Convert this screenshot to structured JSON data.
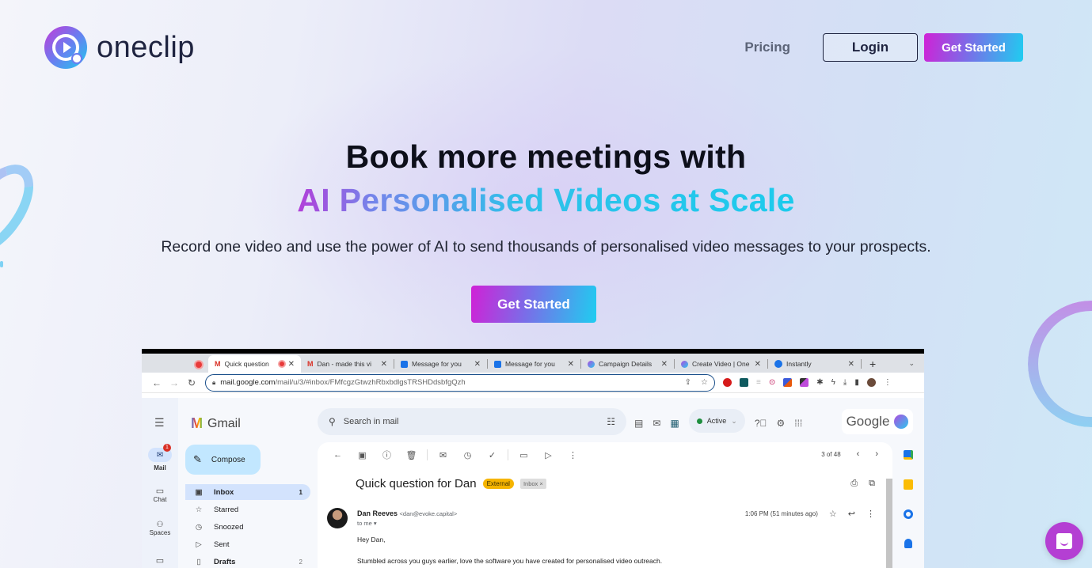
{
  "brand": {
    "name": "oneclip",
    "logo_icon": "play-circle-icon"
  },
  "nav": {
    "pricing": "Pricing",
    "login": "Login",
    "get_started": "Get Started"
  },
  "hero": {
    "title": "Book more meetings with",
    "subtitle": "AI Personalised Videos at Scale",
    "description": "Record one video and use the power of AI to send thousands of personalised video messages to your prospects.",
    "cta": "Get Started"
  },
  "colors": {
    "gradient_start": "#d021d6",
    "gradient_end": "#1fcdf0",
    "dark_text": "#1f2440",
    "chat_fab": "#b43fd3"
  },
  "mockup": {
    "tabs": [
      {
        "label": "Quick question",
        "icon": "gmail-icon",
        "active": true
      },
      {
        "label": "Dan - made this vi",
        "icon": "gmail-icon"
      },
      {
        "label": "Message for you",
        "icon": "video-icon"
      },
      {
        "label": "Message for you",
        "icon": "video-icon"
      },
      {
        "label": "Campaign Details",
        "icon": "oneclip-icon"
      },
      {
        "label": "Create Video | One",
        "icon": "oneclip-icon"
      },
      {
        "label": "Instantly",
        "icon": "instantly-icon"
      }
    ],
    "url_host": "mail.google.com",
    "url_path": "/mail/u/3/#inbox/FMfcgzGtwzhRbxbdlgsTRSHDdsbfgQzh",
    "gmail": {
      "app_name": "Gmail",
      "compose": "Compose",
      "search_placeholder": "Search in mail",
      "status": "Active",
      "google_label": "Google",
      "rail": [
        {
          "label": "Mail",
          "badge": "1"
        },
        {
          "label": "Chat"
        },
        {
          "label": "Spaces"
        },
        {
          "label": "Meet"
        }
      ],
      "folders": [
        {
          "label": "Inbox",
          "count": "1",
          "active": true
        },
        {
          "label": "Starred",
          "count": ""
        },
        {
          "label": "Snoozed",
          "count": ""
        },
        {
          "label": "Sent",
          "count": ""
        },
        {
          "label": "Drafts",
          "count": "2"
        }
      ],
      "pager": "3 of 48",
      "subject": "Quick question for Dan",
      "labels": [
        "External",
        "Inbox ×"
      ],
      "sender_name": "Dan Reeves",
      "sender_email": "<dan@evoke.capital>",
      "to": "to me ▾",
      "time": "1:06 PM (51 minutes ago)",
      "greeting": "Hey Dan,",
      "body": "Stumbled across you guys earlier, love the software you have created for personalised video outreach."
    }
  }
}
